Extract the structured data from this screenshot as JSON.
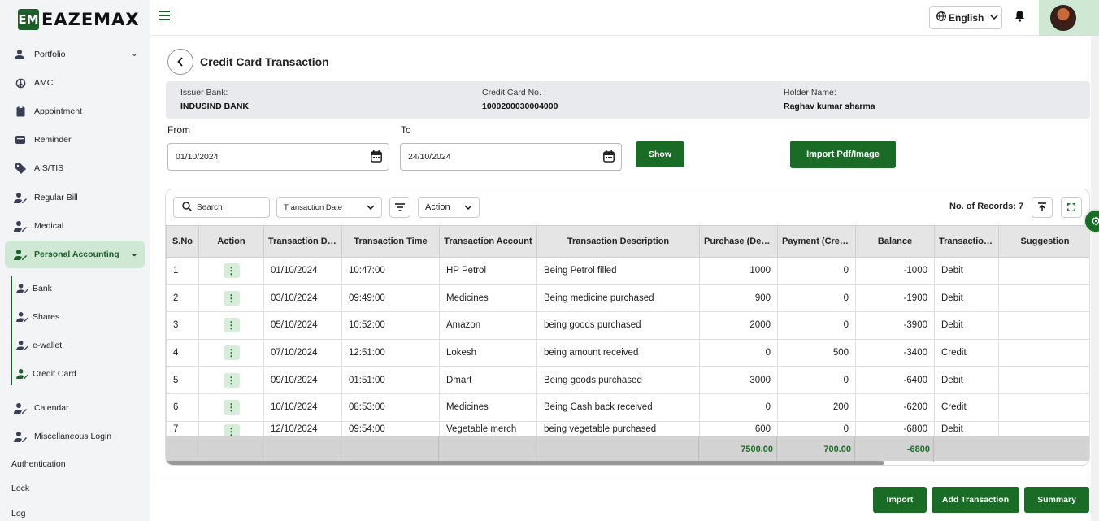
{
  "brand": {
    "logo_mark": "EM",
    "name": "EAZEMAX",
    "accent": "#1a6b26"
  },
  "sidebar": {
    "items": [
      {
        "label": "Portfolio",
        "icon": "user-icon",
        "chevron": "⌄"
      },
      {
        "label": "AMC",
        "icon": "peace-icon"
      },
      {
        "label": "Appointment",
        "icon": "clipboard-icon"
      },
      {
        "label": "Reminder",
        "icon": "reminder-icon"
      },
      {
        "label": "AIS/TIS",
        "icon": "tag-icon"
      },
      {
        "label": "Regular Bill",
        "icon": "user-edit-icon"
      },
      {
        "label": "Medical",
        "icon": "user-edit-icon"
      },
      {
        "label": "Personal Accounting",
        "icon": "user-edit-icon",
        "chevron": "⌄"
      }
    ],
    "sub_items": [
      {
        "label": "Bank"
      },
      {
        "label": "Shares"
      },
      {
        "label": "e-wallet"
      },
      {
        "label": "Credit Card"
      }
    ],
    "more_items": [
      {
        "label": "Calendar"
      },
      {
        "label": "Miscellaneous Login"
      }
    ],
    "plain_items": [
      "Authentication",
      "Lock",
      "Log"
    ]
  },
  "header": {
    "language": "English"
  },
  "page": {
    "title": "Credit Card Transaction",
    "issuer_label": "Issuer Bank:",
    "issuer_value": "INDUSIND BANK",
    "card_label": "Credit Card No. :",
    "card_value": "1000200030004000",
    "holder_label": "Holder Name:",
    "holder_value": "Raghav kumar sharma",
    "from_label": "From",
    "from_value": "01/10/2024",
    "to_label": "To",
    "to_value": "24/10/2024",
    "show_btn": "Show",
    "import_pdf_btn": "Import Pdf/Image"
  },
  "toolbar": {
    "search_placeholder": "Search",
    "date_filter": "Transaction Date",
    "action": "Action",
    "records": "No. of Records: 7"
  },
  "table": {
    "columns": [
      "S.No",
      "Action",
      "Transaction Date",
      "Transaction Time",
      "Transaction Account",
      "Transaction Description",
      "Purchase (Debit)",
      "Payment (Credit)",
      "Balance",
      "Transaction Type",
      "Suggestion"
    ],
    "rows": [
      [
        "1",
        "01/10/2024",
        "10:47:00",
        "HP Petrol",
        "Being Petrol filled",
        "1000",
        "0",
        "-1000",
        "Debit"
      ],
      [
        "2",
        "03/10/2024",
        "09:49:00",
        "Medicines",
        "Being medicine purchased",
        "900",
        "0",
        "-1900",
        "Debit"
      ],
      [
        "3",
        "05/10/2024",
        "10:52:00",
        "Amazon",
        "being goods purchased",
        "2000",
        "0",
        "-3900",
        "Debit"
      ],
      [
        "4",
        "07/10/2024",
        "12:51:00",
        "Lokesh",
        "being amount received",
        "0",
        "500",
        "-3400",
        "Credit"
      ],
      [
        "5",
        "09/10/2024",
        "01:51:00",
        "Dmart",
        "Being goods purchased",
        "3000",
        "0",
        "-6400",
        "Debit"
      ],
      [
        "6",
        "10/10/2024",
        "08:53:00",
        "Medicines",
        "Being Cash back received",
        "0",
        "200",
        "-6200",
        "Credit"
      ],
      [
        "7",
        "12/10/2024",
        "09:54:00",
        "Vegetable merch",
        "being vegetable purchased",
        "600",
        "0",
        "-6800",
        "Debit"
      ]
    ],
    "totals": {
      "purchase": "7500.00",
      "payment": "700.00",
      "balance": "-6800"
    }
  },
  "footer": {
    "import": "Import",
    "add": "Add Transaction",
    "summary": "Summary"
  }
}
